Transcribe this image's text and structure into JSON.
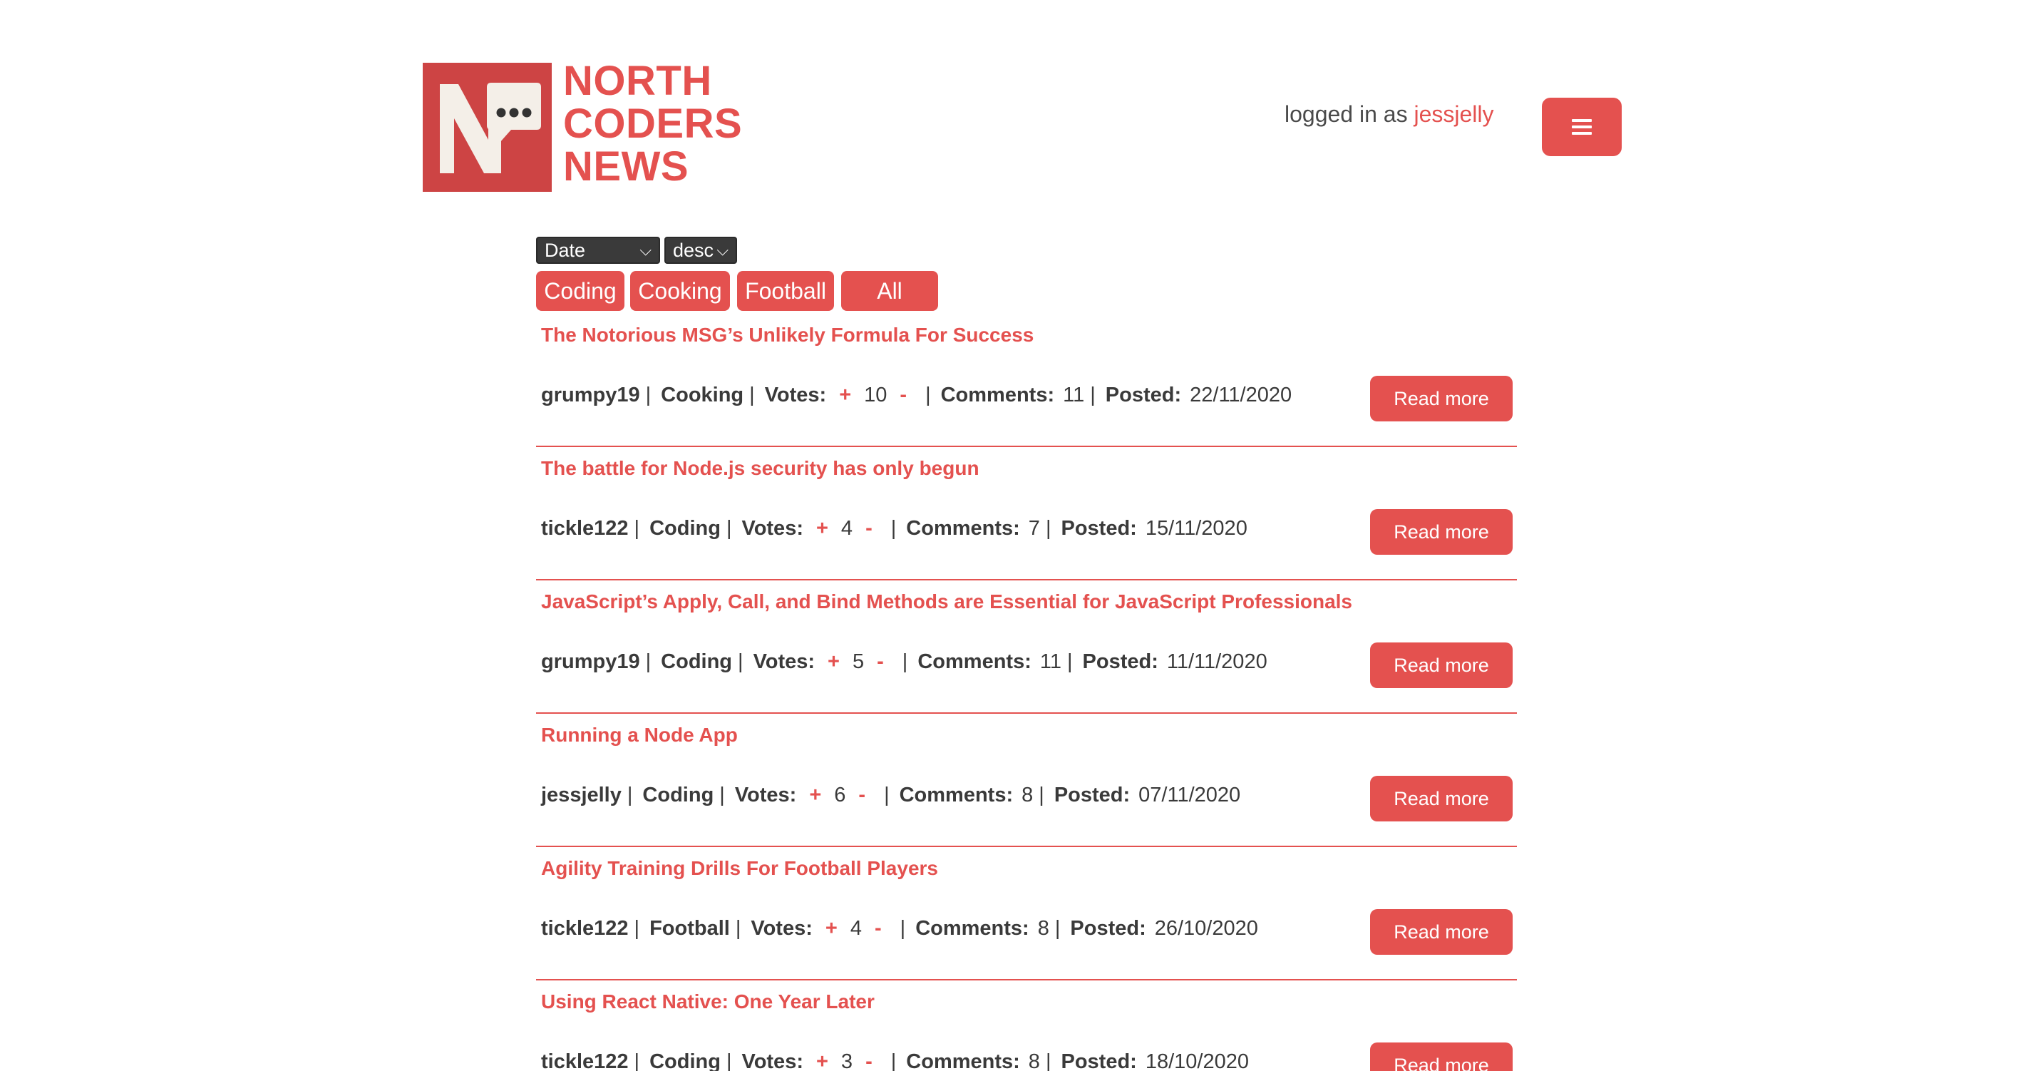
{
  "header": {
    "logo_lines": [
      "NORTH",
      "CODERS",
      "NEWS"
    ],
    "login_prefix": "logged in as",
    "username": "jessjelly",
    "menu_icon": "hamburger-icon"
  },
  "controls": {
    "sort_by": "Date",
    "order": "desc",
    "topics": [
      "Coding",
      "Cooking",
      "Football",
      "All"
    ]
  },
  "labels": {
    "votes": "Votes:",
    "comments": "Comments:",
    "posted": "Posted:",
    "upvote": "+",
    "downvote": "-",
    "read_more": "Read more",
    "pipe": "|"
  },
  "articles": [
    {
      "title": "The Notorious MSG’s Unlikely Formula For Success",
      "author": "grumpy19",
      "topic": "Cooking",
      "votes": "10",
      "comments": "11",
      "posted": "22/11/2020"
    },
    {
      "title": "The battle for Node.js security has only begun",
      "author": "tickle122",
      "topic": "Coding",
      "votes": "4",
      "comments": "7",
      "posted": "15/11/2020"
    },
    {
      "title": "JavaScript’s Apply, Call, and Bind Methods are Essential for JavaScript Professionals",
      "author": "grumpy19",
      "topic": "Coding",
      "votes": "5",
      "comments": "11",
      "posted": "11/11/2020"
    },
    {
      "title": "Running a Node App",
      "author": "jessjelly",
      "topic": "Coding",
      "votes": "6",
      "comments": "8",
      "posted": "07/11/2020"
    },
    {
      "title": "Agility Training Drills For Football Players",
      "author": "tickle122",
      "topic": "Football",
      "votes": "4",
      "comments": "8",
      "posted": "26/10/2020"
    },
    {
      "title": "Using React Native: One Year Later",
      "author": "tickle122",
      "topic": "Coding",
      "votes": "3",
      "comments": "8",
      "posted": "18/10/2020"
    }
  ]
}
